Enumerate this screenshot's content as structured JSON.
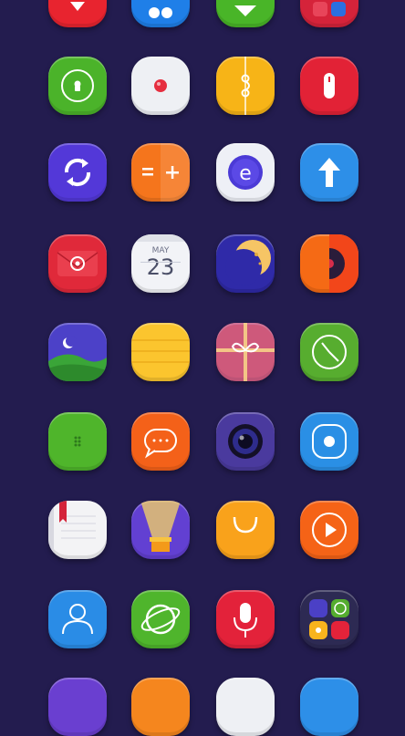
{
  "calendar": {
    "month": "MAY",
    "day": "23"
  },
  "calculator": {
    "symbols": "= +"
  },
  "icons": [
    {
      "name": "map-pin-app-icon",
      "color": "#e8242f"
    },
    {
      "name": "dots-app-icon",
      "color": "#1f7fe8"
    },
    {
      "name": "download-app-icon",
      "color": "#49b528"
    },
    {
      "name": "toggle-app-icon",
      "color": "#d5233a"
    },
    {
      "name": "contacts-lock-app-icon",
      "color": "#4bb32a"
    },
    {
      "name": "recorder-app-icon",
      "color": "#eef0f4"
    },
    {
      "name": "file-manager-app-icon",
      "color": "#f7b417"
    },
    {
      "name": "mouse-app-icon",
      "color": "#e22236"
    },
    {
      "name": "sync-app-icon",
      "color": "#5338d8"
    },
    {
      "name": "calculator-app-icon",
      "color": "#f5751c"
    },
    {
      "name": "browser-app-icon",
      "color": "#eef0f6"
    },
    {
      "name": "upload-app-icon",
      "color": "#2d8fe8"
    },
    {
      "name": "email-app-icon",
      "color": "#e0293a"
    },
    {
      "name": "calendar-app-icon",
      "color": "#f2f3f7"
    },
    {
      "name": "moon-app-icon",
      "color": "#2f2aa8"
    },
    {
      "name": "music-app-icon",
      "color": "#f56a15"
    },
    {
      "name": "gallery-app-icon",
      "color": "#4c41c8"
    },
    {
      "name": "notes-app-icon",
      "color": "#fbc52e"
    },
    {
      "name": "gift-app-icon",
      "color": "#f1624a"
    },
    {
      "name": "clock-app-icon",
      "color": "#57ad2f"
    },
    {
      "name": "phone-dialer-app-icon",
      "color": "#4fb52b"
    },
    {
      "name": "messages-app-icon",
      "color": "#f46119"
    },
    {
      "name": "camera-app-icon",
      "color": "#4a3a9e"
    },
    {
      "name": "screen-recorder-app-icon",
      "color": "#2a8fe5"
    },
    {
      "name": "bookmark-app-icon",
      "color": "#f3f3f5"
    },
    {
      "name": "flashlight-app-icon",
      "color": "#6240d2"
    },
    {
      "name": "shopping-bag-app-icon",
      "color": "#f9a21b"
    },
    {
      "name": "video-player-app-icon",
      "color": "#f56317"
    },
    {
      "name": "contacts-app-icon",
      "color": "#2a8ce6"
    },
    {
      "name": "planet-browser-app-icon",
      "color": "#4fb52c"
    },
    {
      "name": "voice-recorder-app-icon",
      "color": "#e3223a"
    },
    {
      "name": "folder-app-icon",
      "color": "#2d2a53"
    },
    {
      "name": "partial-app-icon-1",
      "color": "#6a3fd0"
    },
    {
      "name": "partial-app-icon-2",
      "color": "#f5861e"
    },
    {
      "name": "partial-app-icon-3",
      "color": "#eef0f4"
    },
    {
      "name": "partial-app-icon-4",
      "color": "#2d8fe8"
    }
  ]
}
